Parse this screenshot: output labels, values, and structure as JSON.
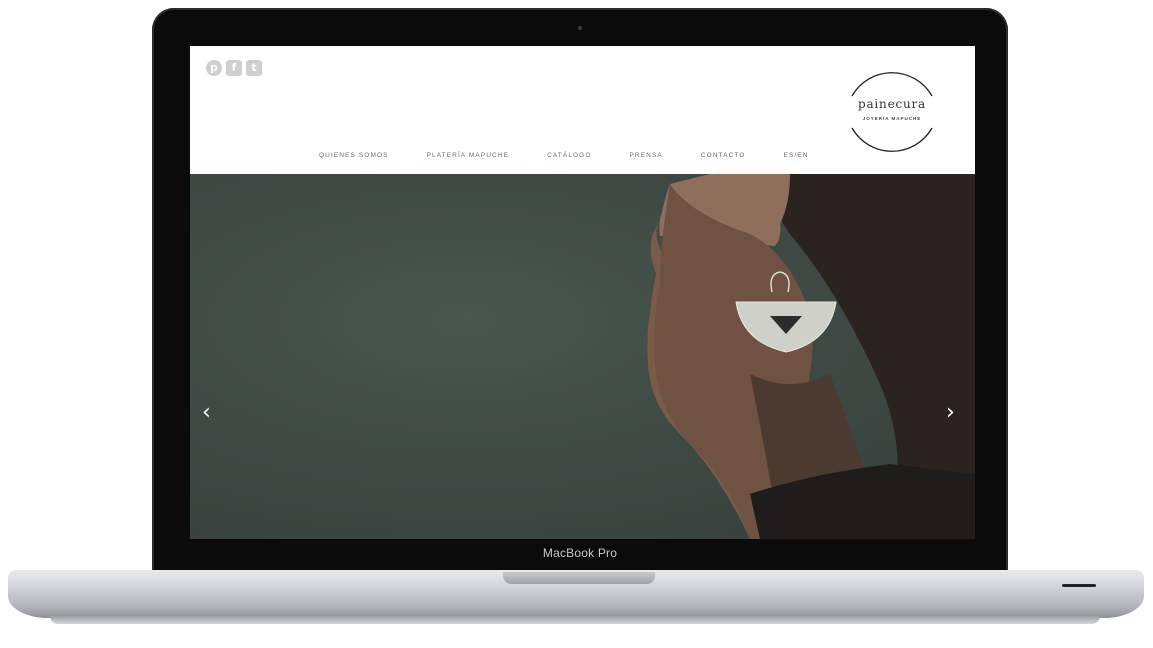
{
  "device": {
    "label": "MacBook Pro"
  },
  "site": {
    "social_icons": [
      "pinterest-icon",
      "facebook-icon",
      "twitter-icon"
    ],
    "nav": [
      {
        "label": "QUIENES SOMOS"
      },
      {
        "label": "PLATERÍA MAPUCHE"
      },
      {
        "label": "CATÁLOGO"
      },
      {
        "label": "PRENSA"
      },
      {
        "label": "CONTACTO"
      },
      {
        "label": "ES/EN"
      }
    ],
    "logo": {
      "name": "painecura",
      "tagline": "JOYERÍA MAPUCHE"
    },
    "hero": {
      "prev_arrow": "‹",
      "next_arrow": "›"
    }
  },
  "colors": {
    "hero_bg": "#3f4a45",
    "nav_text": "#6b6b6b"
  }
}
